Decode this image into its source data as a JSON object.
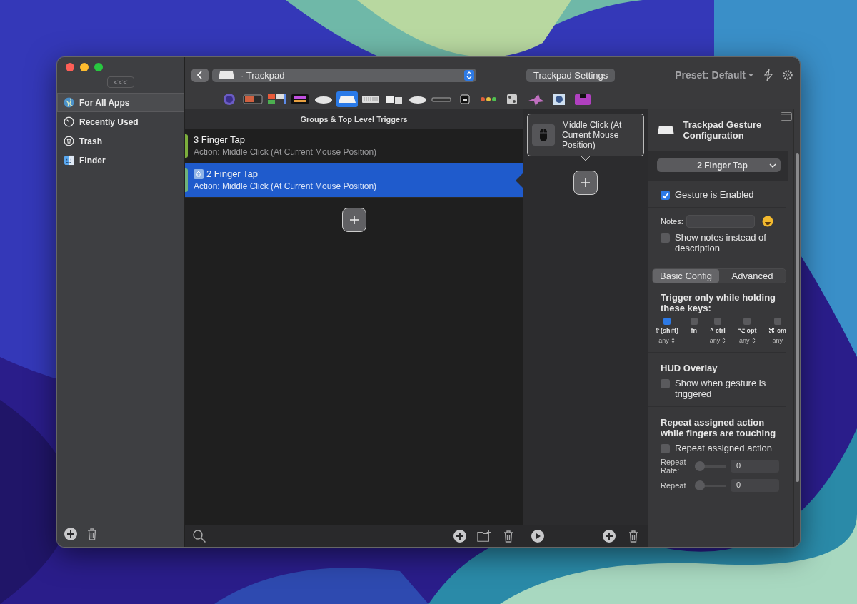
{
  "sidebar": {
    "collapse_label": "<<<",
    "items": [
      {
        "label": "For All Apps",
        "kind": "globe",
        "selected": true
      },
      {
        "label": "Recently Used",
        "kind": "timer",
        "selected": false
      },
      {
        "label": "Trash",
        "kind": "trash",
        "selected": false
      },
      {
        "label": "Finder",
        "kind": "finder",
        "selected": false
      }
    ]
  },
  "toolbar": {
    "device_bullet": "·",
    "device_select": "Trackpad",
    "settings_button": "Trackpad Settings",
    "preset": "Preset: Default",
    "devices": [
      {
        "kind": "orb",
        "selected": false
      },
      {
        "kind": "touchbar",
        "selected": false
      },
      {
        "kind": "panel",
        "selected": false
      },
      {
        "kind": "grid",
        "selected": false
      },
      {
        "kind": "mouse",
        "selected": false
      },
      {
        "kind": "trackpad",
        "selected": true
      },
      {
        "kind": "keyboard",
        "selected": false
      },
      {
        "kind": "keys",
        "selected": false
      },
      {
        "kind": "mouse",
        "selected": false
      },
      {
        "kind": "remote",
        "selected": false
      },
      {
        "kind": "camera",
        "selected": false
      },
      {
        "kind": "dots",
        "selected": false
      },
      {
        "kind": "gamepad",
        "selected": false
      },
      {
        "kind": "star",
        "selected": false
      },
      {
        "kind": "chip",
        "selected": false
      },
      {
        "kind": "tray",
        "selected": false
      }
    ]
  },
  "triggers": {
    "header": "Groups & Top Level Triggers",
    "rows": [
      {
        "title": "3 Finger Tap",
        "action": "Action: Middle Click (At Current Mouse Position)",
        "selected": false,
        "shift_icon": false,
        "color": "#7cae3c"
      },
      {
        "title": "2 Finger Tap",
        "action": "Action: Middle Click (At Current Mouse Position)",
        "selected": true,
        "shift_icon": true,
        "color": "#6fb27a"
      }
    ]
  },
  "actions": {
    "items": [
      {
        "label": "Middle Click (At Current Mouse Position)"
      }
    ]
  },
  "config": {
    "title": "Trackpad Gesture Configuration",
    "gesture_select": "2 Finger Tap",
    "enabled": {
      "label": "Gesture is Enabled",
      "checked": true
    },
    "notes_label": "Notes:",
    "show_notes": {
      "label": "Show notes instead of description",
      "checked": false
    },
    "tabs": [
      {
        "label": "Basic Config",
        "selected": true
      },
      {
        "label": "Advanced",
        "selected": false
      }
    ],
    "keys_heading": "Trigger only while holding these keys:",
    "keys": [
      {
        "label": "⇧(shift)",
        "checked": true,
        "mode": "any",
        "stepper": true
      },
      {
        "label": "fn",
        "checked": false
      },
      {
        "label": "^ ctrl",
        "checked": false,
        "mode": "any",
        "stepper": true
      },
      {
        "label": "⌥ opt",
        "checked": false,
        "mode": "any",
        "stepper": true
      },
      {
        "label": "⌘ cm",
        "checked": false,
        "mode": "any"
      }
    ],
    "hud_heading": "HUD Overlay",
    "hud": {
      "label": "Show when gesture is triggered",
      "checked": false
    },
    "repeat_heading": "Repeat assigned action while fingers are touching",
    "repeat": {
      "label": "Repeat assigned action",
      "checked": false
    },
    "sliders": [
      {
        "label": "Repeat Rate:",
        "level": 0,
        "value": "0"
      },
      {
        "label": "Repeat",
        "level": 0,
        "value": "0"
      }
    ]
  }
}
